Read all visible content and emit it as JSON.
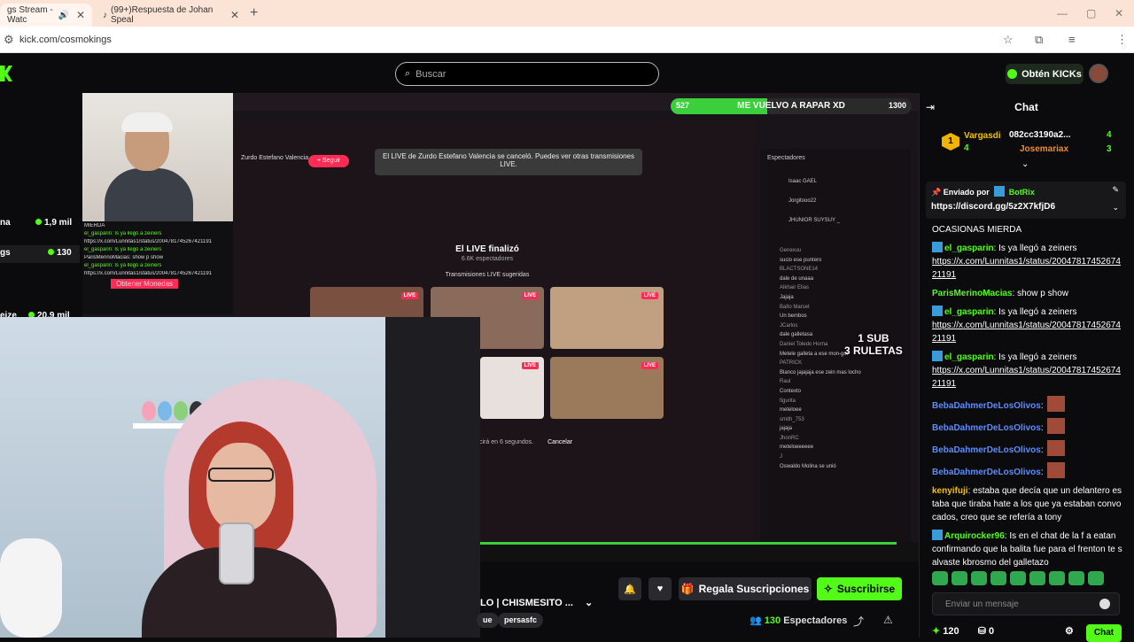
{
  "browser": {
    "tabs": [
      {
        "label": "gs Stream - Watc",
        "active": true
      },
      {
        "label": "(99+)Respuesta de Johan Speal",
        "active": false
      }
    ],
    "new_tab": "+",
    "url": "kick.com/cosmokings"
  },
  "kick": {
    "search_placeholder": "Buscar",
    "kicks_label": "Obtén KICKs"
  },
  "sidebar": {
    "items": [
      {
        "name": "na",
        "viewers": "1,9 mil"
      },
      {
        "name": "gs",
        "viewers": "130"
      },
      {
        "name": "eize",
        "viewers": "20,9 mil"
      }
    ]
  },
  "stream": {
    "goal_count": "527",
    "goal_title": "ME VUELVO A RAPAR XD",
    "goal_target": "1300",
    "goal_progress_fraction": 0.4,
    "notice": "El LIVE de Zurdo Estefano Valencia se canceló. Puedes ver otras transmisiones LIVE.",
    "streamer_name": "Zurdo Estefano Valencia",
    "follow_label": "+ Seguir",
    "live_finished": "El LIVE finalizó",
    "live_finished_viewers": "6.6K espectadores",
    "suggested": "Transmisiones LIVE sugeridas",
    "cancel_text": "cirá en 6 segundos.",
    "cancel_label": "Cancelar",
    "live_badge": "LIVE",
    "viewers_header": "Espectadores",
    "viewer_list": [
      "Isaac GAEL",
      "Jorgitooo22",
      "JHUNIOR SUYSUY _"
    ],
    "inner_comments": [
      "Genexuu",
      "sucio ese puntero",
      "BLACTSONE14",
      "dale de unaaa",
      "Alkhair Elias",
      "Jajaja",
      "Balto Marset",
      "Un bembos",
      "JCarlos",
      "dale galletasa",
      "Daniel Toledo Horna",
      "Metele galleta a ese mon-gol",
      "PATRICK",
      "Blanco jajajaja ese zein mas locho",
      "Raul",
      "Contexto",
      "figurita",
      "meteloee",
      "smith_753",
      "jajaja",
      "JhonRC",
      "meteloeeeeee",
      "J",
      "Oswaldo Molina  se unió"
    ],
    "overlay_text": "1 SUB\n3 RULETAS",
    "inner_chat": [
      "MIERDA",
      "el_gasparin: Is ya llegó a zeiners",
      "https://x.com/Lunnitas1/status/2004781745267421191",
      "el_gasparin: Is ya llegó a zeiners",
      "ParisMerinoMacias: show p show",
      "el_gasparin: Is ya llegó a zeiners",
      "https://x.com/Lunnitas1/status/2004781745267421191",
      "Obtener Monedas"
    ]
  },
  "info": {
    "title": "LO | CHISMESITO ...",
    "tags": [
      "ue",
      "persasfc"
    ],
    "gift_label": "Regala Suscripciones",
    "subscribe_label": "Suscribirse",
    "viewers_count": "130",
    "viewers_label": "Espectadores"
  },
  "chat": {
    "title": "Chat",
    "leaderboard": [
      {
        "rank": "1",
        "name": "Vargasdi",
        "value": "4"
      },
      {
        "name": "082cc3190a2...",
        "value": "4"
      },
      {
        "name": "Josemariax",
        "value": "3"
      }
    ],
    "pinned_by_label": "Enviado por",
    "pinned_by": "BotRix",
    "pinned_link": "https://discord.gg/5z2X7kfjD6",
    "top_fragment": "OCASIONAS MIERDA",
    "messages": [
      {
        "user": "el_gasparin",
        "color": "#53fc18",
        "text": "Is ya llegó a zeiners",
        "link": "https://x.com/Lunnitas1/status/2004781745267421191"
      },
      {
        "user": "ParisMerinoMacias",
        "color": "#53fc18",
        "text": "show p show",
        "link": ""
      },
      {
        "user": "el_gasparin",
        "color": "#53fc18",
        "text": "Is ya llegó a zeiners",
        "link": "https://x.com/Lunnitas1/status/2004781745267421191"
      },
      {
        "user": "el_gasparin",
        "color": "#53fc18",
        "text": "Is ya llegó a zeiners",
        "link": "https://x.com/Lunnitas1/status/2004781745267421191"
      },
      {
        "user": "BebaDahmerDeLosOlivos",
        "color": "#5b8cff",
        "text": "",
        "link": ""
      },
      {
        "user": "BebaDahmerDeLosOlivos",
        "color": "#5b8cff",
        "text": "",
        "link": ""
      },
      {
        "user": "BebaDahmerDeLosOlivos",
        "color": "#5b8cff",
        "text": "",
        "link": ""
      },
      {
        "user": "BebaDahmerDeLosOlivos",
        "color": "#5b8cff",
        "text": "",
        "link": ""
      },
      {
        "user": "kenyifuji",
        "color": "#f0c000",
        "text": "estaba que decía que un delantero estaba que tiraba hate a los que ya estaban convocados, creo que se refería a tony",
        "link": ""
      },
      {
        "user": "Arquirocker96",
        "color": "#53fc18",
        "text": "Is en el chat de la f a eatan confirmando que la balita fue para el frenton te salvaste kbrosmo del galletazo",
        "link": ""
      }
    ],
    "input_placeholder": "Enviar un mensaje",
    "points": "120",
    "drops": "0",
    "send_label": "Chat"
  }
}
